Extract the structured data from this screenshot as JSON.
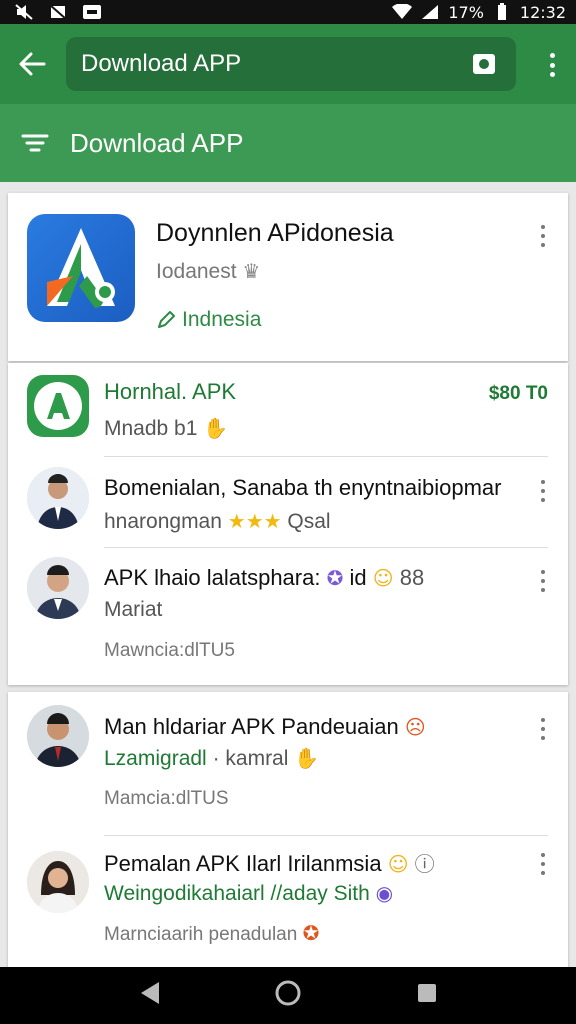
{
  "status_bar": {
    "battery": "17%",
    "time": "12:32"
  },
  "app_bar": {
    "search_text": "Download APP"
  },
  "sub_bar": {
    "title": "Download APP"
  },
  "featured": {
    "title": "Doynnlen APidonesia",
    "subtitle": "Iodanest",
    "region": "Indnesia"
  },
  "list": [
    {
      "title": "Hornhal. APK",
      "subtitle": "Mnadb b1",
      "price": "$80 T0"
    },
    {
      "title": "Bomenialan, Sanaba th enyntnaibiopmar",
      "subtitle": "hnarongman",
      "rating_text": "Qsal",
      "stars": 3
    },
    {
      "title": "APK lhaio lalatsphara:",
      "title_suffix": "id",
      "title_tail": "88",
      "subtitle": "Mariat",
      "meta": "Mawncia:dlTU5"
    },
    {
      "title": "Man hldariar APK Pandeuaian",
      "subtitle": "Lzamigradl",
      "subtitle_tail": "· kamral",
      "meta": "Mamcia:dlTUS"
    },
    {
      "title": "Pemalan APK Ilarl Irilanmsia",
      "subtitle": "Weingodikahaiarl //aday Sith",
      "meta": "Marnciaarih penadulan"
    }
  ]
}
